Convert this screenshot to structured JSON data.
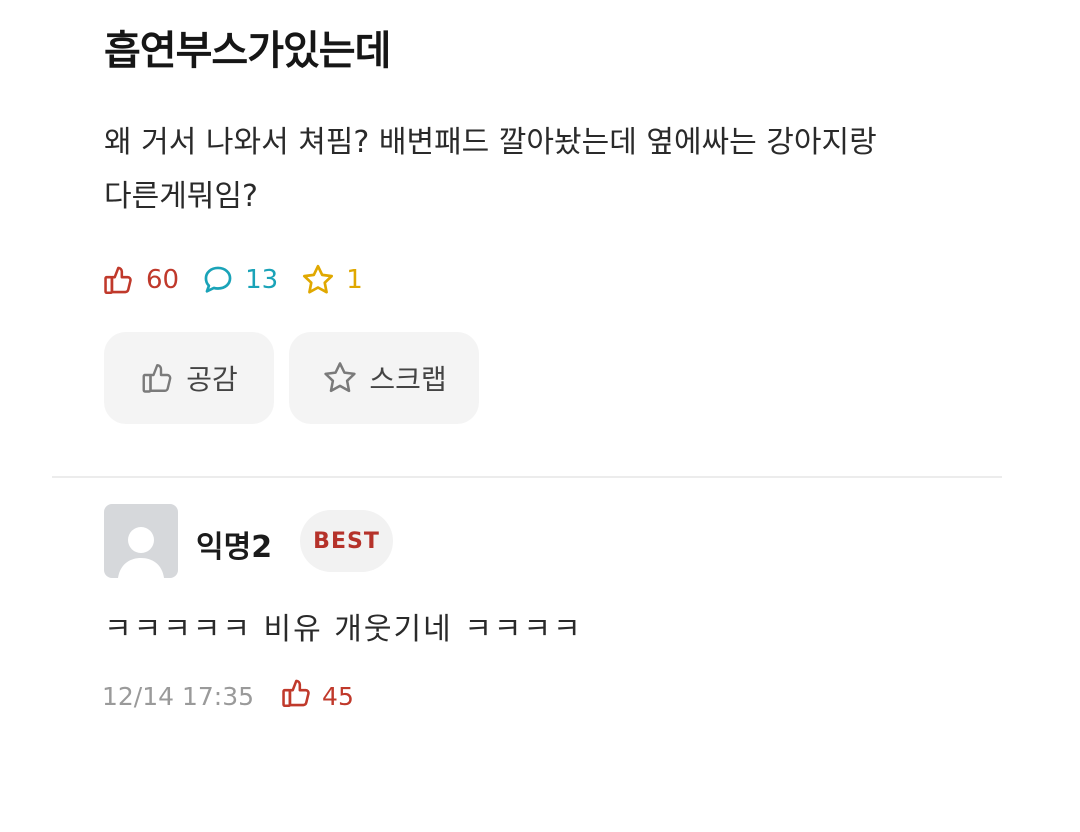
{
  "post": {
    "title": "흡연부스가있는데",
    "body_lines": [
      "왜 거서 나와서 쳐핌? 배변패드 깔아놨는데 옆에싸는 강아지랑",
      "다른게뭐임?"
    ],
    "stats": {
      "likes": "60",
      "comments": "13",
      "scraps": "1"
    },
    "actions": {
      "like_label": "공감",
      "scrap_label": "스크랩"
    }
  },
  "comment": {
    "author": "익명2",
    "badge": "BEST",
    "text": "ㅋㅋㅋㅋㅋ 비유 개웃기네 ㅋㅋㅋㅋ",
    "timestamp": "12/14 17:35",
    "likes": "45"
  },
  "colors": {
    "like": "#c0392b",
    "comment": "#1aa3b8",
    "scrap": "#e0a800",
    "badge_text": "#b5322a"
  },
  "icons": {
    "like": "thumbs-up-icon",
    "comment": "speech-bubble-icon",
    "scrap": "star-icon",
    "avatar": "anonymous-user-icon"
  }
}
